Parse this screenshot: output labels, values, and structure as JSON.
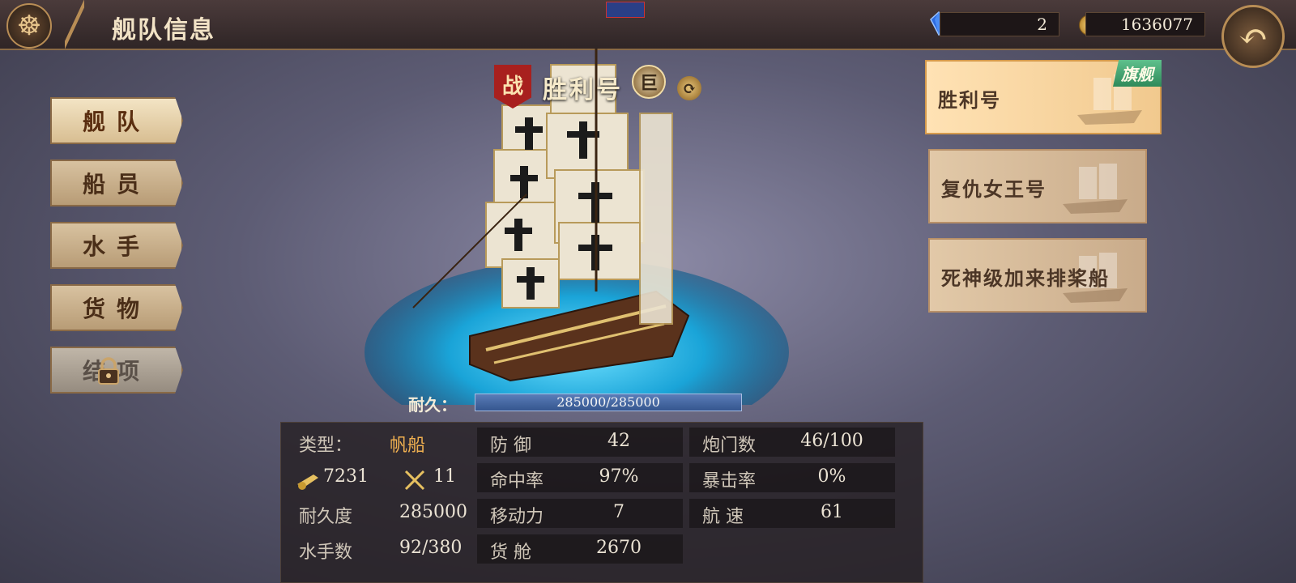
{
  "header": {
    "title": "舰队信息",
    "gems": "2",
    "gold": "1636077",
    "menu_icon": "ship-wheel-icon",
    "back_icon": "back-arrow-icon"
  },
  "nav": {
    "items": [
      {
        "label": "舰队",
        "active": true
      },
      {
        "label": "船员",
        "active": false
      },
      {
        "label": "水手",
        "active": false
      },
      {
        "label": "货物",
        "active": false
      },
      {
        "label": "结项",
        "locked": true
      }
    ]
  },
  "ship": {
    "badge": "战",
    "name": "胜利号",
    "rank": "巨",
    "durability_label": "耐久：",
    "durability_text": "285000/285000",
    "durability_fraction": 1.0
  },
  "stats": {
    "type_label": "类型：",
    "type_value": "帆船",
    "firepower": "7231",
    "melee": "11",
    "durability_label": "耐久度",
    "durability_value": "285000",
    "sailors_label": "水手数",
    "sailors_value": "92/380",
    "defense_label": "防  御",
    "defense_value": "42",
    "hit_label": "命中率",
    "hit_value": "97%",
    "move_label": "移动力",
    "move_value": "7",
    "cargo_label": "货  舱",
    "cargo_value": "2670",
    "ports_label": "炮门数",
    "ports_value": "46/100",
    "crit_label": "暴击率",
    "crit_value": "0%",
    "speed_label": "航  速",
    "speed_value": "61"
  },
  "fleet": [
    {
      "name": "胜利号",
      "flagship": "旗舰",
      "active": true
    },
    {
      "name": "复仇女王号",
      "active": false
    },
    {
      "name": "死神级加来排桨船",
      "active": false
    }
  ],
  "colors": {
    "accent_gold": "#b88d55",
    "flagship_green": "#2f8a5a",
    "war_red": "#a8201e",
    "type_orange": "#f0b050"
  }
}
